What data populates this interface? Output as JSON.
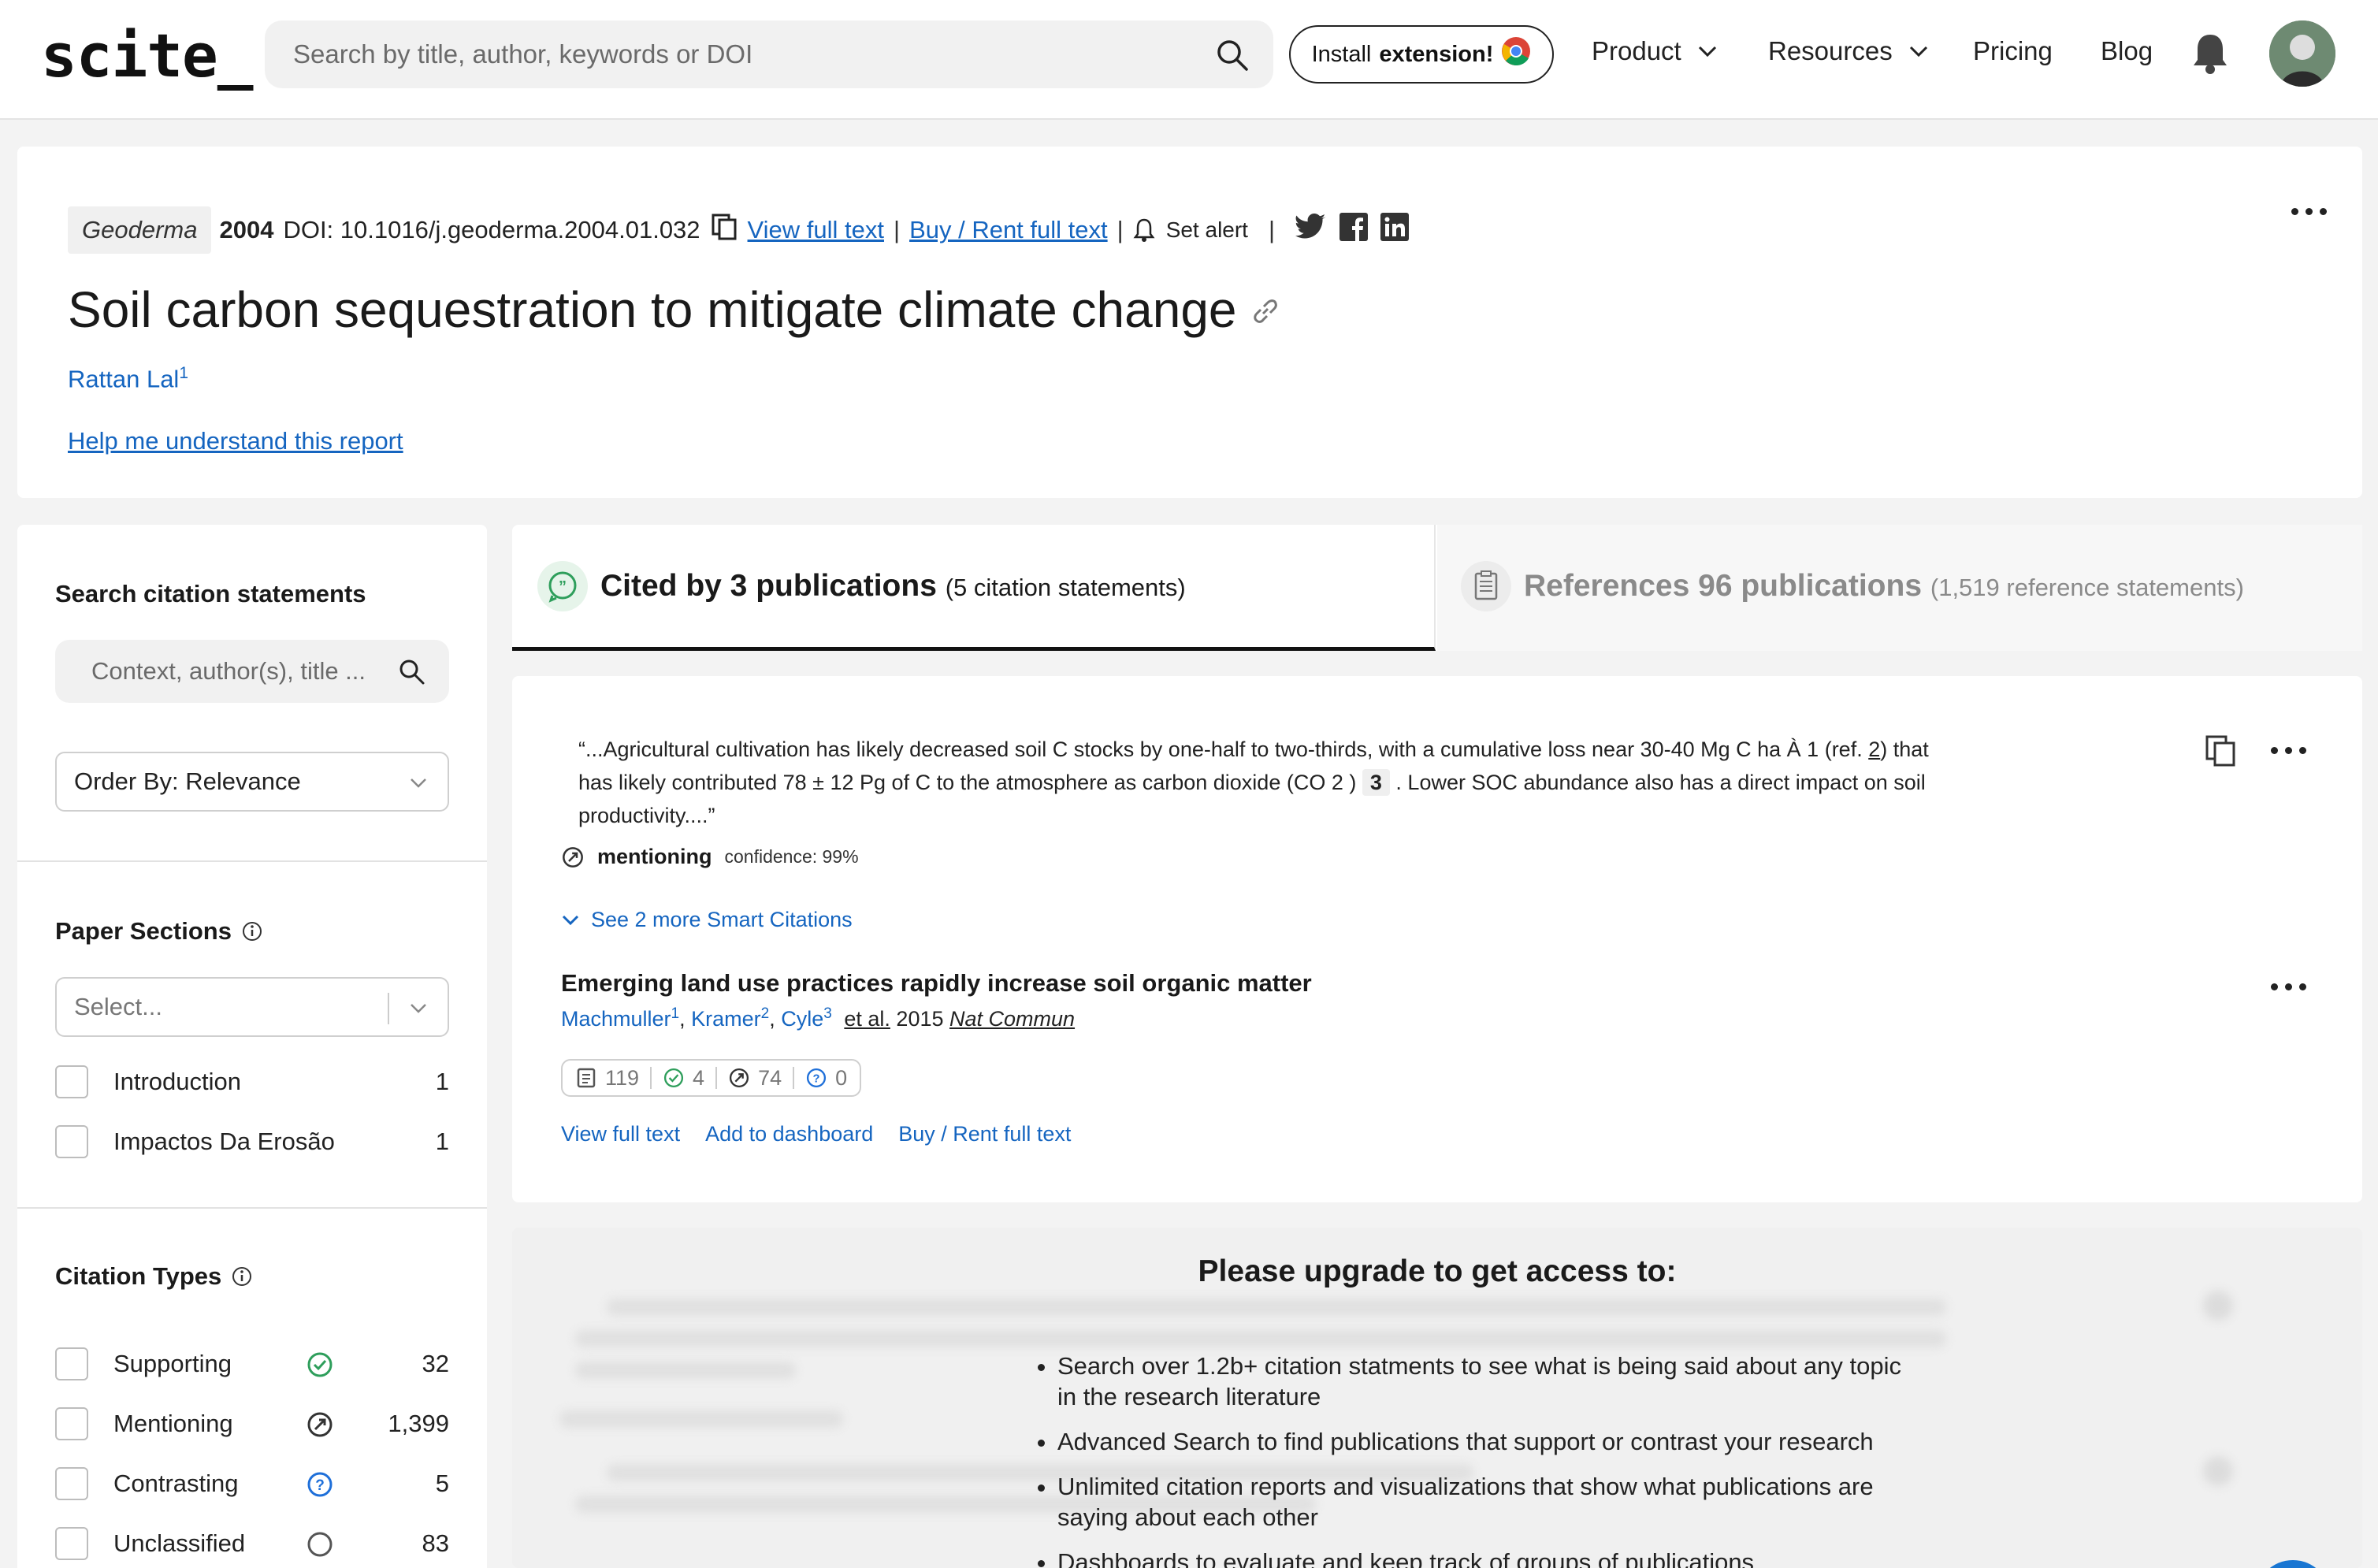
{
  "nav": {
    "logo": "scite_",
    "search_placeholder": "Search by title, author, keywords or DOI",
    "install_prefix": "Install",
    "install_bold": "extension!",
    "links": [
      {
        "label": "Product",
        "dropdown": true
      },
      {
        "label": "Resources",
        "dropdown": true
      },
      {
        "label": "Pricing",
        "dropdown": false
      },
      {
        "label": "Blog",
        "dropdown": false
      }
    ]
  },
  "paper": {
    "journal": "Geoderma",
    "year": "2004",
    "doi": "DOI: 10.1016/j.geoderma.2004.01.032",
    "view_full_text": "View full text",
    "buy_rent": "Buy / Rent full text",
    "set_alert": "Set alert",
    "title": "Soil carbon sequestration to mitigate climate change",
    "author": "Rattan Lal",
    "author_sup": "1",
    "help_link": "Help me understand this report"
  },
  "sidebar": {
    "search_heading": "Search citation statements",
    "search_placeholder": "Context, author(s), title ...",
    "order_by": "Order By: Relevance",
    "sections_heading": "Paper Sections",
    "sections_select_placeholder": "Select...",
    "sections": [
      {
        "label": "Introduction",
        "count": "1"
      },
      {
        "label": "Impactos Da Erosão",
        "count": "1"
      }
    ],
    "types_heading": "Citation Types",
    "types": [
      {
        "label": "Supporting",
        "count": "32",
        "icon": "supporting-icon",
        "color": "#2e9e5b"
      },
      {
        "label": "Mentioning",
        "count": "1,399",
        "icon": "mentioning-icon",
        "color": "#333333"
      },
      {
        "label": "Contrasting",
        "count": "5",
        "icon": "contrasting-icon",
        "color": "#1e6fd9"
      },
      {
        "label": "Unclassified",
        "count": "83",
        "icon": "unclassified-icon",
        "color": "#555555"
      }
    ]
  },
  "tabs": {
    "cited_by": "Cited by 3 publications",
    "cited_by_sub": "(5 citation statements)",
    "references": "References 96 publications",
    "references_sub": "(1,519 reference statements)"
  },
  "citation": {
    "quote_part1": "“...Agricultural cultivation has likely decreased soil C stocks by one-half to two-thirds, with a cumulative loss near 30-40 Mg C ha À 1 (ref.",
    "quote_ref": "2",
    "quote_part2": ") that has likely contributed 78 ± 12 Pg of C to the atmosphere as carbon dioxide (CO 2 )",
    "quote_num": "3",
    "quote_part3": ". Lower SOC abundance also has a direct impact on soil productivity....”",
    "type_label": "mentioning",
    "confidence": "confidence: 99%",
    "see_more": "See 2 more Smart Citations",
    "pub_title": "Emerging land use practices rapidly increase soil organic matter",
    "authors": [
      {
        "name": "Machmuller",
        "sup": "1"
      },
      {
        "name": "Kramer",
        "sup": "2"
      },
      {
        "name": "Cyle",
        "sup": "3"
      }
    ],
    "et_al": "et al.",
    "pub_year": "2015",
    "pub_journal": "Nat Commun",
    "tally": {
      "total": "119",
      "supporting": "4",
      "mentioning": "74",
      "contrasting": "0"
    },
    "actions": [
      "View full text",
      "Add to dashboard",
      "Buy / Rent full text"
    ]
  },
  "upgrade": {
    "title": "Please upgrade to get access to:",
    "items": [
      "Search over 1.2b+ citation statments to see what is being said about any topic in the research literature",
      "Advanced Search to find publications that support or contrast your research",
      "Unlimited citation reports and visualizations that show what publications are saying about each other",
      "Dashboards to evaluate and keep track of groups of publications"
    ]
  }
}
